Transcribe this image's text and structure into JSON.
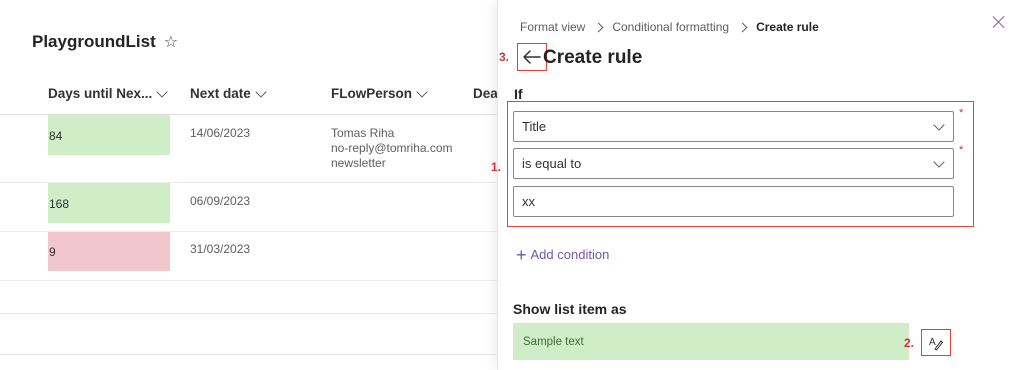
{
  "list": {
    "title": "PlaygroundList",
    "columns": [
      "Days until Nex...",
      "Next date",
      "FLowPerson",
      "Dea"
    ],
    "rows": [
      {
        "days": "84",
        "date": "14/06/2023",
        "person": [
          "Tomas Riha",
          "no-reply@tomriha.com",
          "newsletter"
        ],
        "color": "#cfeec8"
      },
      {
        "days": "168",
        "date": "06/09/2023",
        "person": [],
        "color": "#cfeec8"
      },
      {
        "days": "9",
        "date": "31/03/2023",
        "person": [],
        "color": "#f2c6cd"
      }
    ]
  },
  "panel": {
    "breadcrumb": [
      "Format view",
      "Conditional formatting",
      "Create rule"
    ],
    "title": "Create rule",
    "if_label": "If",
    "condition": {
      "field": "Title",
      "operator": "is equal to",
      "value": "xx"
    },
    "required_mark": "*",
    "add_condition": "Add condition",
    "show_as_label": "Show list item as",
    "sample_text": "Sample text"
  },
  "annotations": {
    "m1": "1.",
    "m2": "2.",
    "m3": "3."
  },
  "colors": {
    "accent": "#7058a8",
    "highlight": "#e0453a",
    "green_bg": "#cfeec8",
    "red_bg": "#f2c6cd"
  }
}
